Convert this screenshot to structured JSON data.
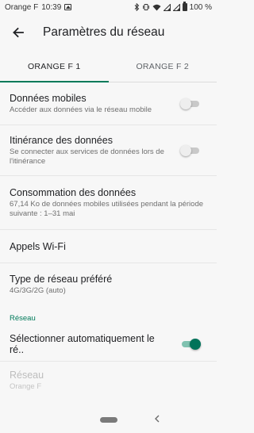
{
  "status_bar": {
    "carrier": "Orange F",
    "time": "10:39",
    "battery": "100 %",
    "icons": [
      "image-icon",
      "bluetooth-icon",
      "vibrate-icon",
      "wifi-icon",
      "signal-icon",
      "signal-icon",
      "battery-icon"
    ]
  },
  "app_bar": {
    "title": "Paramètres du réseau",
    "back_icon": "arrow-left-icon"
  },
  "tabs": [
    {
      "label": "ORANGE F 1",
      "active": true
    },
    {
      "label": "ORANGE F 2",
      "active": false
    }
  ],
  "settings": {
    "mobile_data": {
      "title": "Données mobiles",
      "subtitle": "Accéder aux données via le réseau mobile",
      "enabled": false
    },
    "roaming": {
      "title": "Itinérance des données",
      "subtitle": "Se connecter aux services de données lors de l'itinérance",
      "enabled": false
    },
    "data_usage": {
      "title": "Consommation des données",
      "subtitle": "67,14 Ko de données mobiles utilisées pendant la période suivante : 1–31 mai"
    },
    "wifi_calls": {
      "title": "Appels Wi-Fi"
    },
    "network_type": {
      "title": "Type de réseau préféré",
      "subtitle": "4G/3G/2G (auto)"
    },
    "network_section": {
      "label": "Réseau"
    },
    "auto_select": {
      "title": "Sélectionner automatiquement le ré..",
      "enabled": true
    },
    "network": {
      "title": "Réseau",
      "subtitle": "Orange F"
    }
  },
  "nav_bar": {
    "home_icon": "home-pill-icon",
    "back_icon": "chevron-left-icon"
  },
  "colors": {
    "accent": "#007a5a",
    "background": "#f7f7f7"
  }
}
